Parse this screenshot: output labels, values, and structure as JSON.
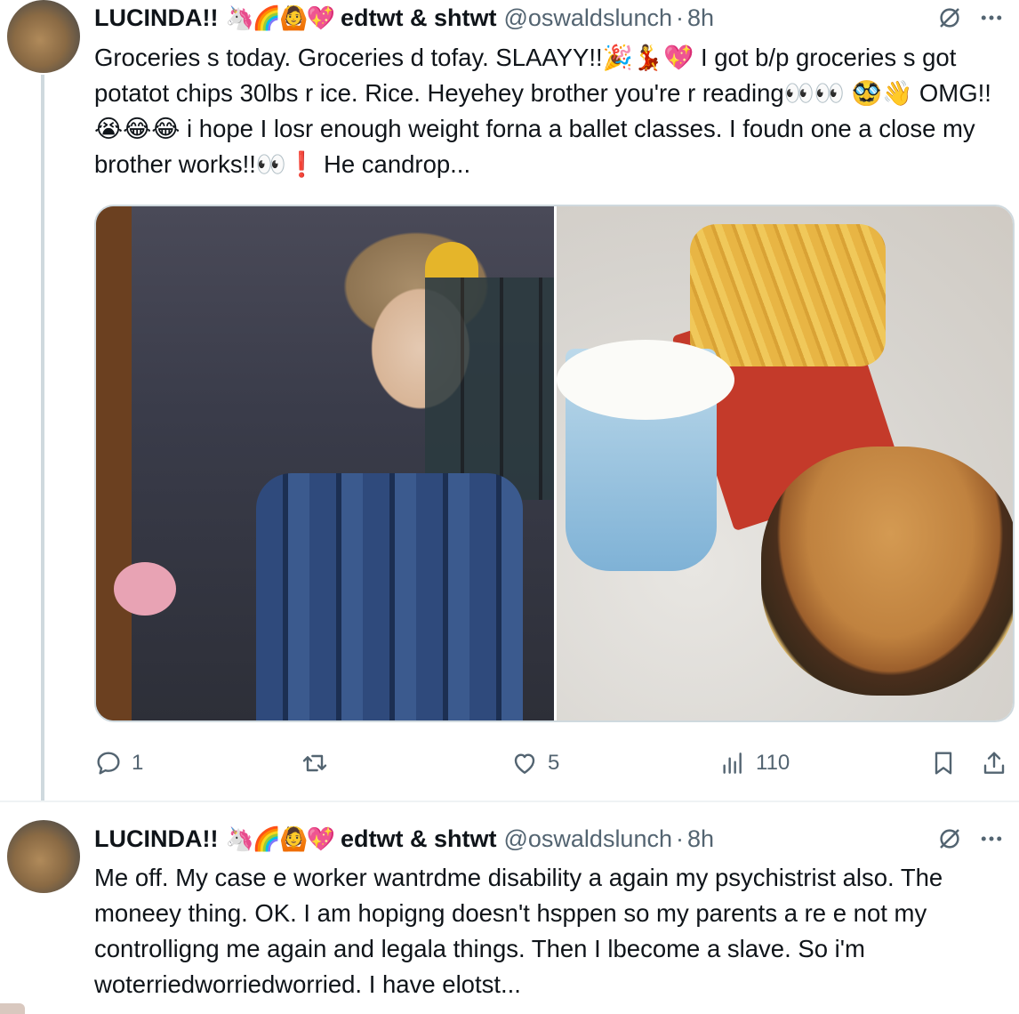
{
  "tweets": [
    {
      "display_name": "LUCINDA!!",
      "name_emojis": "🦄🌈🙆💖",
      "extra_name": "edtwt & shtwt",
      "handle": "@oswaldslunch",
      "separator": "·",
      "time": "8h",
      "text": "Groceries s today. Groceries d tofay. SLAAYY!!🎉💃💖 I got b/p groceries s got potatot chips 30lbs r ice. Rice. Heyehey brother you're r reading👀👀 🥸👋 OMG!!😭😂😂 i hope I losr enough weight forna a ballet classes. I foudn one a close my brother works!!👀❗ He candrop...",
      "actions": {
        "replies": "1",
        "retweets": "",
        "likes": "5",
        "views": "110"
      }
    },
    {
      "display_name": "LUCINDA!!",
      "name_emojis": "🦄🌈🙆💖",
      "extra_name": "edtwt & shtwt",
      "handle": "@oswaldslunch",
      "separator": "·",
      "time": "8h",
      "text": "Me off. My case e worker wantrdme disability a again my psychistrist also. The moneey thing. OK. I am hopigng doesn't hsppen so my parents a re e not my controlligng me again and legala things. Then I lbecome a slave. So i'm woterriedworriedworried. I have elotst..."
    }
  ],
  "icons": {
    "grok": "grok-icon",
    "more": "more-icon",
    "reply": "reply-icon",
    "retweet": "retweet-icon",
    "like": "heart-icon",
    "views": "views-icon",
    "bookmark": "bookmark-icon",
    "share": "share-icon"
  },
  "colors": {
    "text": "#0f1419",
    "secondary": "#536471",
    "border": "#cfd9de"
  }
}
